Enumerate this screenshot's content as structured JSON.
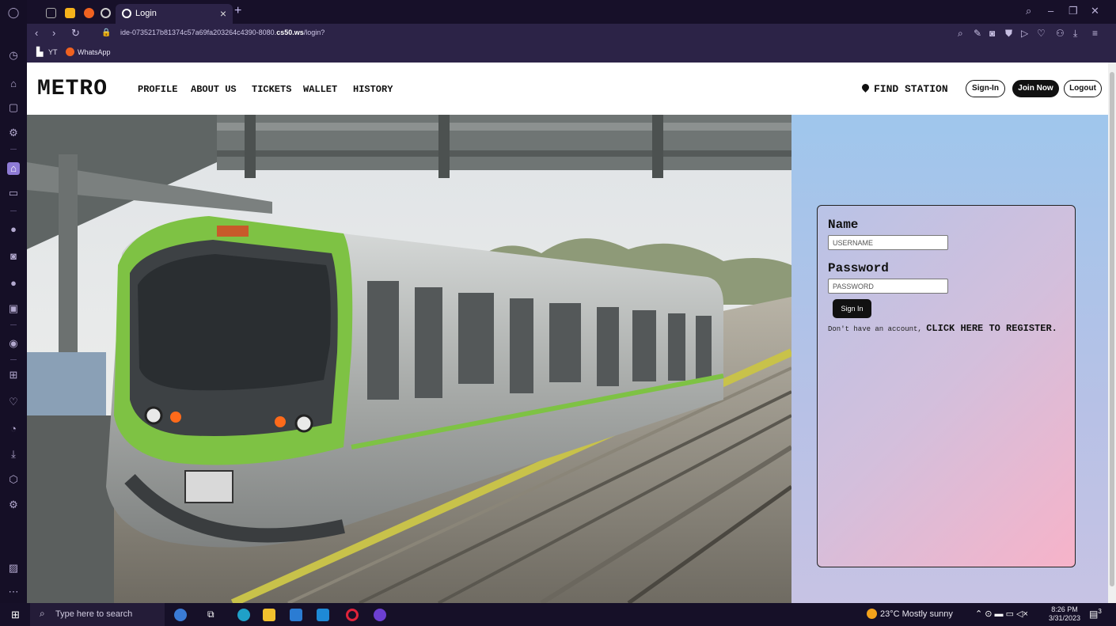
{
  "browser": {
    "tab_title": "Login",
    "tab_close": "×",
    "new_tab": "+",
    "url_prefix": "ide-0735217b81374c57a69fa203264c4390-8080.",
    "url_bold": "cs50.ws",
    "url_suffix": "/login?",
    "bookmarks": [
      "YT",
      "WhatsApp"
    ],
    "window_controls": [
      "–",
      "❐",
      "✕"
    ]
  },
  "navbar": {
    "brand": "METRO",
    "links": [
      "PROFILE",
      "ABOUT US",
      "TICKETS",
      "WALLET",
      "HISTORY"
    ],
    "find_station": "FIND STATION",
    "signin_label": "Sign-In",
    "join_label": "Join Now",
    "logout_label": "Logout"
  },
  "login": {
    "name_label": "Name",
    "username_placeholder": "USERNAME",
    "password_label": "Password",
    "password_placeholder": "PASSWORD",
    "submit_label": "Sign In",
    "register_prefix": "Don't have an account, ",
    "register_link": "CLICK HERE TO REGISTER."
  },
  "taskbar": {
    "search_placeholder": "Type here to search",
    "weather": "23°C  Mostly sunny",
    "time": "8:26 PM",
    "date": "3/31/2023",
    "notifications": "3"
  },
  "colors": {
    "accent": "#8e7bd6",
    "train_green": "#7ec244",
    "panel_top": "#9fc6ec",
    "card_bottom": "#f7b3c9"
  }
}
